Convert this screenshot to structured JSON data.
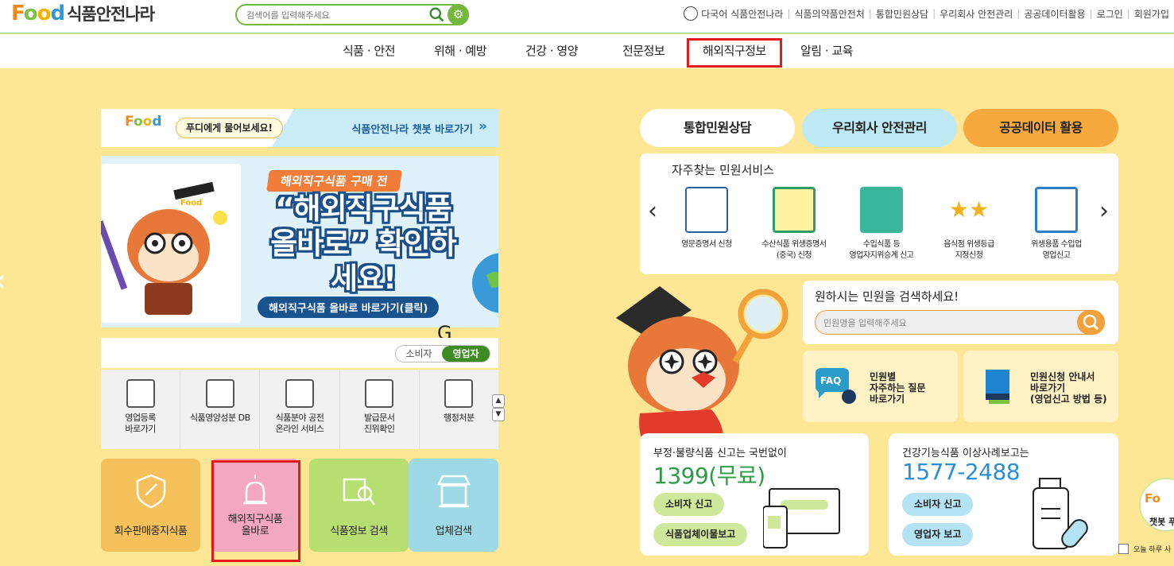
{
  "header": {
    "logo_food": {
      "f": "F",
      "o1": "o",
      "o2": "o",
      "d": "d"
    },
    "logo_text": "식품안전나라",
    "search_placeholder": "검색어를 입력해주세요",
    "links": [
      "다국어 식품안전나라",
      "식품의약품안전처",
      "통합민원상담",
      "우리회사 안전관리",
      "공공데이터활용",
      "로그인",
      "회원가입"
    ]
  },
  "nav": {
    "items": [
      "식품 · 안전",
      "위해 · 예방",
      "건강 · 영양",
      "전문정보",
      "해외직구정보",
      "알림 · 교육"
    ],
    "highlighted": "해외직구정보"
  },
  "chatbot": {
    "pill": "푸디에게 물어보세요!",
    "go": "식품안전나라 챗봇 바로가기",
    "arrow": "»"
  },
  "banner": {
    "tag": "해외직구식품 구매 전",
    "headline": "“해외직구식품 올바로” 확인하세요!",
    "cta": "해외직구식품 올바로 바로가기(클릭)",
    "prev": "‹",
    "badge": "Food"
  },
  "g_mark": "G",
  "toggle": {
    "consumer": "소비자",
    "business": "영업자",
    "active": "영업자"
  },
  "services": [
    {
      "label": "영업등록\n바로가기",
      "icon": "storefront-icon"
    },
    {
      "label": "식품영양성분 DB",
      "icon": "database-icon"
    },
    {
      "label": "식품분야 공전\n온라인 서비스",
      "icon": "book-icon"
    },
    {
      "label": "발급문서\n진위확인",
      "icon": "document-search-icon"
    },
    {
      "label": "행정처분",
      "icon": "siren-icon"
    }
  ],
  "scroll": {
    "up": "▲",
    "down": "▼"
  },
  "tiles": [
    {
      "label": "회수판매중지식품",
      "color": "#f6c15a",
      "icon": "shield-icon"
    },
    {
      "label": "해외직구식품\n올바로",
      "color": "#f4a7c0",
      "icon": "alarm-light-icon"
    },
    {
      "label": "식품정보 검색",
      "color": "#b7de70",
      "icon": "magnifier-icon"
    },
    {
      "label": "업체검색",
      "color": "#9ed9e6",
      "icon": "shop-icon"
    }
  ],
  "tabs": [
    {
      "label": "통합민원상담",
      "color": "#ffffff"
    },
    {
      "label": "우리회사 안전관리",
      "color": "#bde9f5"
    },
    {
      "label": "공공데이터 활용",
      "color": "#f7a93e"
    }
  ],
  "frequent": {
    "title": "자주찾는 민원서비스",
    "prev": "‹",
    "next": "›",
    "items": [
      {
        "label": "영문증명서 신청",
        "icon": "certificate-icon"
      },
      {
        "label": "수산식품 위생증명서\n(중국) 신청",
        "icon": "china-cert-icon"
      },
      {
        "label": "수입식품 등\n영업자지위승계 신고",
        "icon": "handshake-icon"
      },
      {
        "label": "음식점 위생등급\n지정신청",
        "icon": "stars-icon"
      },
      {
        "label": "위생용품 수입업\n영업신고",
        "icon": "sanitary-monitor-icon"
      }
    ]
  },
  "civil_search": {
    "question": "원하시는 민원을 검색하세요!",
    "placeholder": "민원명을 입력해주세요"
  },
  "faq_cards": [
    {
      "text": "민원별\n자주하는 질문\n바로가기",
      "icon": "faq-icon",
      "badge": "FAQ"
    },
    {
      "text": "민원신청 안내서\n바로가기\n(영업신고 방법 등)",
      "icon": "guide-book-icon"
    }
  ],
  "reports": [
    {
      "heading": "부정·불량식품 신고는 국번없이",
      "number": "1399(무료)",
      "number_color": "#2f9a47",
      "btn1": "소비자 신고",
      "btn2": "식품업체이물보고",
      "btn_color": "#cfe89b"
    },
    {
      "heading": "건강기능식품 이상사례보고는",
      "number": "1577-2488",
      "number_color": "#2a8fd8",
      "btn1": "소비자 신고",
      "btn2": "영업자 보고",
      "btn_color": "#b4e3f3"
    }
  ],
  "chat_fab": "챗봇 푸",
  "today_hide": "오늘 하루 사",
  "left_chevron": "‹"
}
